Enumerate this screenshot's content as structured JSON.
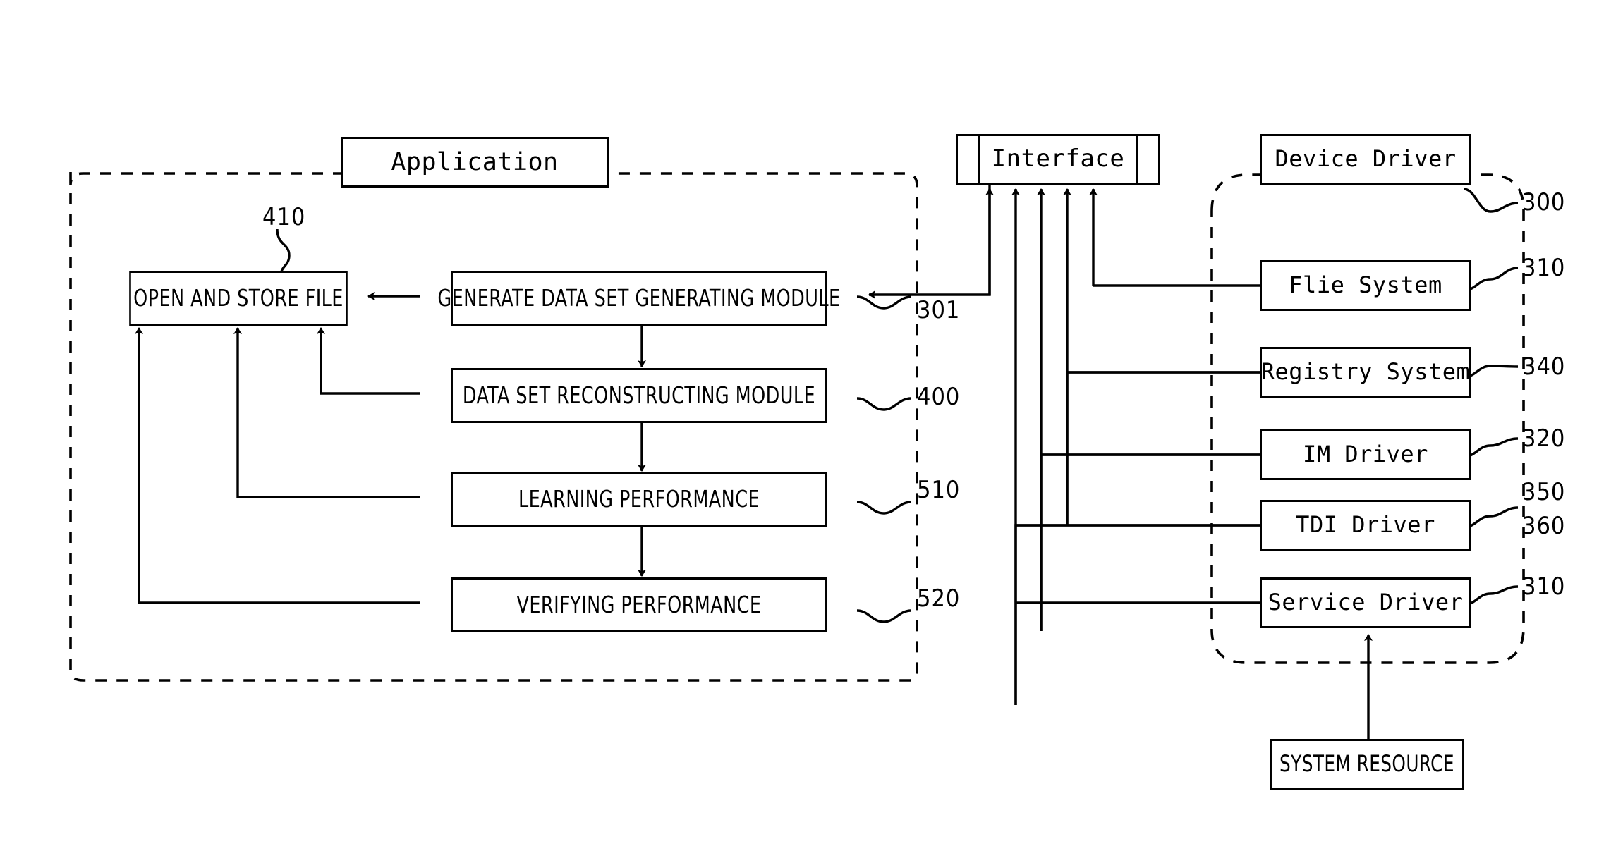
{
  "figure": {
    "domain_note": "patent block diagram",
    "application_group": {
      "label": "Application",
      "boundary_style": "dashed"
    },
    "interface": {
      "label": "Interface"
    },
    "os_group": {
      "boundary_style": "dashed",
      "ref": "300"
    }
  },
  "application_blocks": [
    {
      "id": "open_store",
      "label": "OPEN AND STORE FILE",
      "ref": "410"
    },
    {
      "id": "generate",
      "label": "GENERATE DATA SET GENERATING MODULE",
      "ref": "301"
    },
    {
      "id": "reconstruct",
      "label": "DATA SET RECONSTRUCTING MODULE",
      "ref": "400"
    },
    {
      "id": "learning",
      "label": "LEARNING PERFORMANCE",
      "ref": "510"
    },
    {
      "id": "verifying",
      "label": "VERIFYING PERFORMANCE",
      "ref": "520"
    }
  ],
  "os_blocks": [
    {
      "id": "device_driver",
      "label": "Device Driver",
      "ref": "300"
    },
    {
      "id": "file_system",
      "label": "Flie System",
      "ref": "310"
    },
    {
      "id": "registry_system",
      "label": "Registry System",
      "ref": "340"
    },
    {
      "id": "im_driver",
      "label": "IM Driver",
      "ref": "320"
    },
    {
      "id": "tdi_driver",
      "label": "TDI Driver",
      "ref": "350",
      "ref2": "360"
    },
    {
      "id": "service_driver",
      "label": "Service Driver",
      "ref": "310"
    }
  ],
  "system_resource": {
    "label": "SYSTEM RESOURCE"
  },
  "reference_numbers": {
    "app_410": "410",
    "app_301": "301",
    "app_400": "400",
    "app_510": "510",
    "app_520": "520",
    "os_300": "300",
    "os_310_file": "310",
    "os_340": "340",
    "os_320": "320",
    "os_350": "350",
    "os_360": "360",
    "os_310_service": "310"
  },
  "colors": {
    "line": "#000000",
    "background": "#ffffff"
  }
}
